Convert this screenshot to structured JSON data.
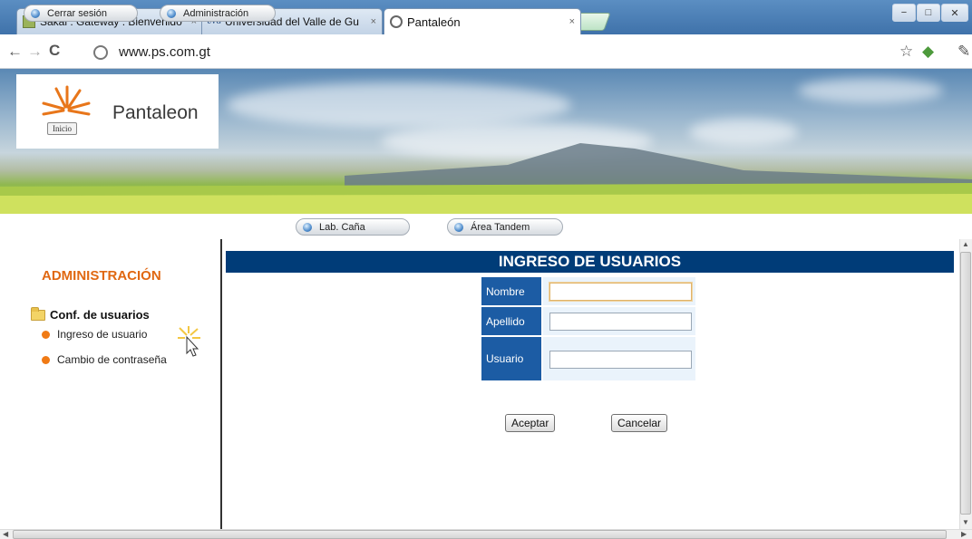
{
  "browser": {
    "tabs": [
      {
        "label": "Sakai : Gateway : Bienvenido",
        "icon": "sakai-favicon",
        "close": "×"
      },
      {
        "label": "Universidad del Valle de Gu",
        "icon": "uvg-favicon",
        "icon_text": "UVG",
        "close": "×"
      },
      {
        "label": "Pantaleón",
        "icon": "globe-favicon",
        "close": "×"
      }
    ],
    "url": "www.ps.com.gt",
    "window_controls": {
      "minimize": "−",
      "maximize": "□",
      "close": "✕"
    }
  },
  "site": {
    "logo_text": "Pantaleon",
    "inicio_label": "Inicio",
    "nav": [
      {
        "label": "Cerrar sesión"
      },
      {
        "label": "Administración"
      },
      {
        "label": "Lab. Caña"
      },
      {
        "label": "Área Tandem"
      }
    ]
  },
  "sidebar": {
    "title": "ADMINISTRACIÓN",
    "section": "Conf. de usuarios",
    "items": [
      {
        "label": "Ingreso de usuario"
      },
      {
        "label": "Cambio de contraseña"
      }
    ]
  },
  "form": {
    "title": "INGRESO DE USUARIOS",
    "fields": [
      {
        "label": "Nombre",
        "value": ""
      },
      {
        "label": "Apellido",
        "value": ""
      },
      {
        "label": "Usuario",
        "value": ""
      }
    ],
    "accept_label": "Aceptar",
    "cancel_label": "Cancelar"
  },
  "colors": {
    "header_bg": "#003c78",
    "label_bg": "#1c5ca4",
    "sidebar_title": "#e06812",
    "bullet": "#f07a14"
  }
}
